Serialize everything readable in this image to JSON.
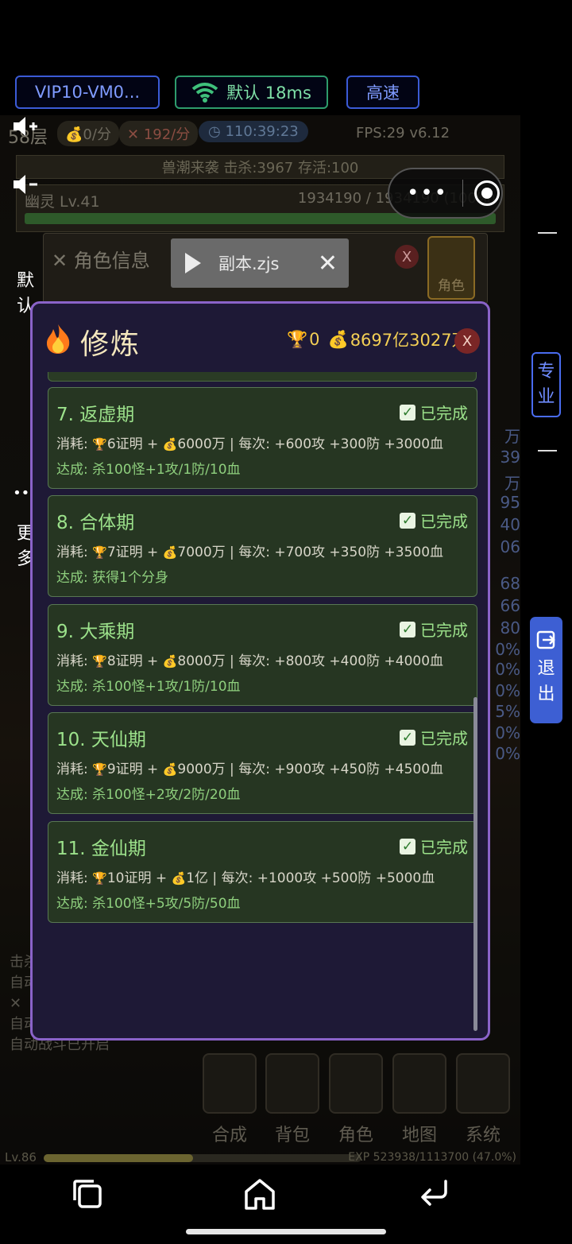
{
  "status_bar": {
    "vip": "VIP10-VM0...",
    "network": "默认 18ms",
    "speed": "高速"
  },
  "hud": {
    "floor": "58层",
    "gold": "0/分",
    "kills": "192/分",
    "timer": "110:39:23",
    "fps": "FPS:29 v6.12",
    "wave": "兽潮来袭  击杀:3967  存活:100",
    "boss_name": "幽灵 Lv.41",
    "boss_hp": "1934190 / 1934190 (100%)"
  },
  "role_panel": {
    "title": "角色信息",
    "close": "X",
    "role_button": "角色"
  },
  "tooltip": {
    "name": "副本.zjs",
    "close": "✕"
  },
  "capsule": {
    "more": "•••"
  },
  "right_toolbar": {
    "default": [
      "默",
      "认"
    ],
    "pro": [
      "专",
      "业"
    ],
    "more_dots": "•••",
    "more": [
      "更",
      "多"
    ],
    "exit": [
      "退",
      "出"
    ]
  },
  "peek_numbers": [
    "万",
    "39",
    "万",
    "95",
    "40",
    "06",
    "68",
    "66",
    "80",
    "0%",
    "0%",
    "0%",
    "5%",
    "0%",
    "0%"
  ],
  "game_log": [
    "击杀",
    "自动",
    "✕",
    "自动",
    "自动战斗已开启"
  ],
  "bottom_menu": [
    "合成",
    "背包",
    "角色",
    "地图",
    "系统"
  ],
  "exp": {
    "level": "Lv.86",
    "text": "EXP 523938/1113700 (47.0%)",
    "progress": 0.47
  },
  "modal": {
    "title": "修炼",
    "trophies": "0",
    "money": "8697亿3027万",
    "close": "X",
    "status_label": "已完成",
    "realms": [
      {
        "name": "7. 返虚期",
        "cost_prefix": "消耗: ",
        "proof": "6证明 + ",
        "money": "6000万",
        "per": " | 每次: +600攻 +300防 +3000血",
        "achieve": "达成: 杀100怪+1攻/1防/10血"
      },
      {
        "name": "8. 合体期",
        "cost_prefix": "消耗: ",
        "proof": "7证明 + ",
        "money": "7000万",
        "per": " | 每次: +700攻 +350防 +3500血",
        "achieve": "达成: 获得1个分身"
      },
      {
        "name": "9. 大乘期",
        "cost_prefix": "消耗: ",
        "proof": "8证明 + ",
        "money": "8000万",
        "per": " | 每次: +800攻 +400防 +4000血",
        "achieve": "达成: 杀100怪+1攻/1防/10血"
      },
      {
        "name": "10. 天仙期",
        "cost_prefix": "消耗: ",
        "proof": "9证明 + ",
        "money": "9000万",
        "per": " | 每次: +900攻 +450防 +4500血",
        "achieve": "达成: 杀100怪+2攻/2防/20血"
      },
      {
        "name": "11. 金仙期",
        "cost_prefix": "消耗: ",
        "proof": "10证明 + ",
        "money": "1亿",
        "per": " | 每次: +1000攻 +500防 +5000血",
        "achieve": "达成: 杀100怪+5攻/5防/50血"
      }
    ]
  },
  "colors": {
    "accent_purple": "#8a63c9",
    "card_green": "#263622",
    "gold": "#f3cf55",
    "blue_button": "#3d5fd3"
  }
}
